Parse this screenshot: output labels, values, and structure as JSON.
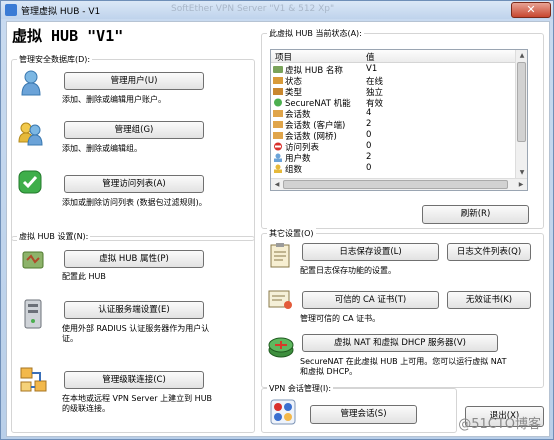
{
  "window": {
    "title": "管理虚拟 HUB - V1",
    "ghost_title": "SoftEther VPN Server \"V1 & 512 Xp\"",
    "close_glyph": "✕",
    "main_title": "虚拟 HUB \"V1\""
  },
  "security": {
    "group_label": "管理安全数据库(D):",
    "users_button": "管理用户(U)",
    "users_desc": "添加、删除或编辑用户账户。",
    "groups_button": "管理组(G)",
    "groups_desc": "添加、删除或编辑组。",
    "acl_button": "管理访问列表(A)",
    "acl_desc": "添加或删除访问列表 (数据包过滤规则)。"
  },
  "hub_settings": {
    "group_label": "虚拟 HUB 设置(N):",
    "props_button": "虚拟 HUB 属性(P)",
    "props_desc": "配置此 HUB",
    "auth_button": "认证服务端设置(E)",
    "auth_desc_1": "使用外部 RADIUS 认证服务器作为用户认",
    "auth_desc_2": "证。",
    "cascade_button": "管理级联连接(C)",
    "cascade_desc_1": "在本地或远程 VPN Server 上建立到 HUB",
    "cascade_desc_2": "的级联连接。"
  },
  "status": {
    "group_label": "此虚拟 HUB 当前状态(A):",
    "col_item": "项目",
    "col_value": "值",
    "rows": [
      {
        "name": "虚拟 HUB 名称",
        "value": "V1"
      },
      {
        "name": "状态",
        "value": "在线"
      },
      {
        "name": "类型",
        "value": "独立"
      },
      {
        "name": "SecureNAT 机能",
        "value": "有效"
      },
      {
        "name": "会话数",
        "value": "4"
      },
      {
        "name": "会话数 (客户端)",
        "value": "2"
      },
      {
        "name": "会话数 (网桥)",
        "value": "0"
      },
      {
        "name": "访问列表",
        "value": "0"
      },
      {
        "name": "用户数",
        "value": "2"
      },
      {
        "name": "组数",
        "value": "0"
      }
    ],
    "refresh_button": "刷新(R)"
  },
  "other": {
    "group_label": "其它设置(O)",
    "log_button": "日志保存设置(L)",
    "logfiles_button": "日志文件列表(Q)",
    "log_desc": "配置日志保存功能的设置。",
    "ca_button": "可信的 CA 证书(T)",
    "invalid_button": "无效证书(K)",
    "ca_desc": "管理可信的 CA 证书。",
    "nat_button": "虚拟 NAT 和虚拟 DHCP 服务器(V)",
    "nat_desc_1": "SecureNAT 在此虚拟 HUB 上可用。您可以运行虚拟 NAT",
    "nat_desc_2": "和虚拟 DHCP。"
  },
  "sessions": {
    "group_label": "VPN 会话管理(I):",
    "sessions_button": "管理会话(S)",
    "exit_button": "退出(X)"
  },
  "watermark": "@51CTO博客"
}
